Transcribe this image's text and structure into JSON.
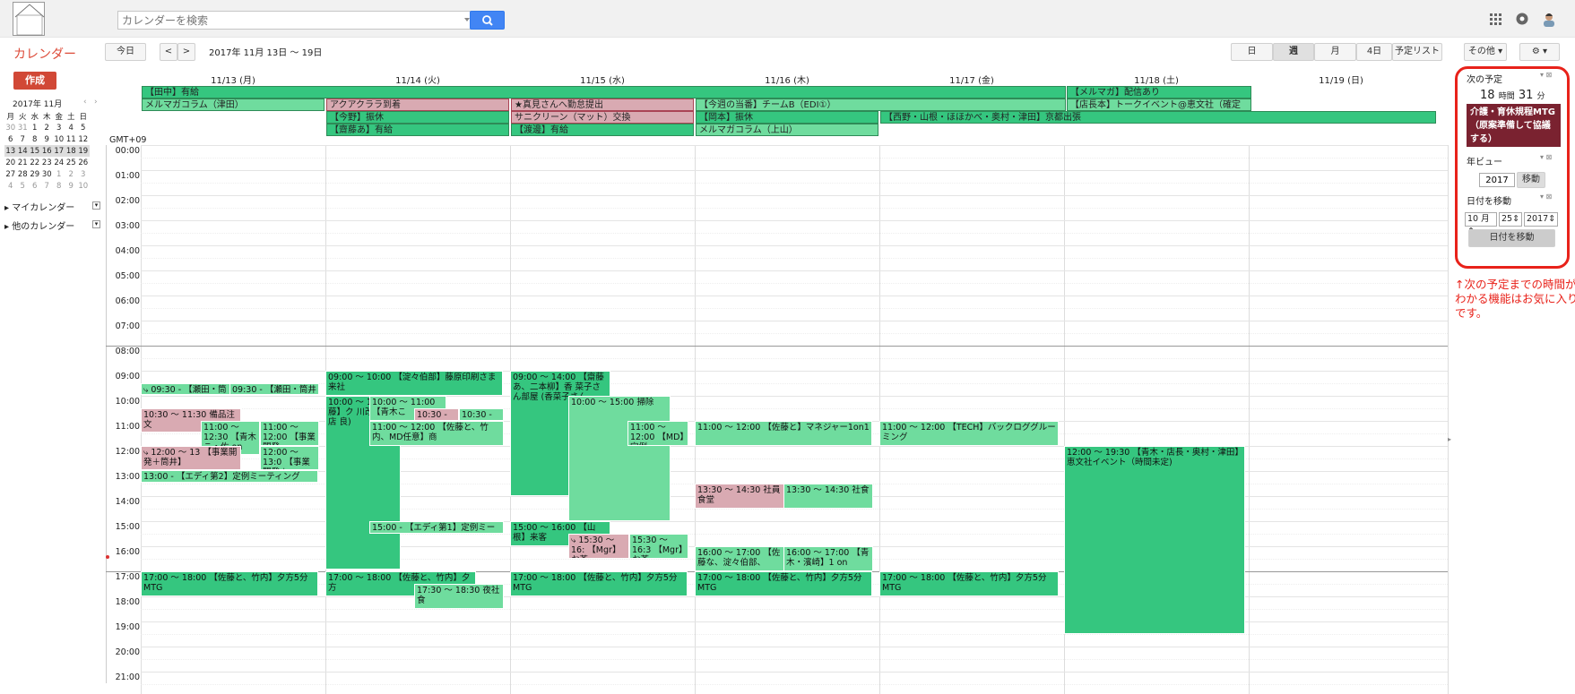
{
  "search": {
    "placeholder": "カレンダーを検索"
  },
  "app_title": "カレンダー",
  "toolbar": {
    "today": "今日",
    "prev": "<",
    "next": ">",
    "date_range": "2017年 11月 13日 〜 19日",
    "views": [
      "日",
      "週",
      "月",
      "4日",
      "予定リスト"
    ],
    "other": "その他",
    "settings": "⚙"
  },
  "create_label": "作成",
  "mini_cal": {
    "title": "2017年 11月",
    "weekdays": [
      "月",
      "火",
      "水",
      "木",
      "金",
      "土",
      "日"
    ],
    "weeks": [
      [
        "30",
        "31",
        "1",
        "2",
        "3",
        "4",
        "5"
      ],
      [
        "6",
        "7",
        "8",
        "9",
        "10",
        "11",
        "12"
      ],
      [
        "13",
        "14",
        "15",
        "16",
        "17",
        "18",
        "19"
      ],
      [
        "20",
        "21",
        "22",
        "23",
        "24",
        "25",
        "26"
      ],
      [
        "27",
        "28",
        "29",
        "30",
        "1",
        "2",
        "3"
      ],
      [
        "4",
        "5",
        "6",
        "7",
        "8",
        "9",
        "10"
      ]
    ]
  },
  "my_calendars": "マイカレンダー",
  "other_calendars": "他のカレンダー",
  "day_headers": [
    "11/13 (月)",
    "11/14 (火)",
    "11/15 (水)",
    "11/16 (木)",
    "11/17 (金)",
    "11/18 (土)",
    "11/19 (日)"
  ],
  "timezone": "GMT+09",
  "hours": [
    "00:00",
    "01:00",
    "02:00",
    "03:00",
    "04:00",
    "05:00",
    "06:00",
    "07:00",
    "08:00",
    "09:00",
    "10:00",
    "11:00",
    "12:00",
    "13:00",
    "14:00",
    "15:00",
    "16:00",
    "17:00",
    "18:00",
    "19:00",
    "20:00",
    "21:00"
  ],
  "allday": [
    "【田中】有給",
    "【メルマガ】配信あり",
    "メルマガコラム（津田）",
    "アクアクララ到着",
    "★真見さんへ勤怠提出",
    "【今週の当番】チームB（EDI①）",
    "【店長本】トークイベント@恵文社（確定",
    "【今野】振休",
    "サニクリーン（マット）交換",
    "【岡本】振休",
    "【西野・山根・ほほかべ・奥村・津田】京都出張",
    "【齋藤あ】有給",
    "【渡邊】有給",
    "メルマガコラム（上山）"
  ],
  "events": {
    "mon1": "⤷ 09:30 - 【瀬田・筒",
    "mon2": "09:30 - 【瀬田・筒井",
    "mon3": "10:30 〜 11:30 備品注文",
    "mon4": "11:00 〜 12:30 【青木こ・佐 on one",
    "mon5": "11:00 〜 12:00 【事業開発",
    "mon6": "⤷ 12:00 〜 13 【事業開発＋筒井】",
    "mon7": "12:00 〜 13:0 【事業開発＋",
    "mon8": "13:00 - 【エディ第2】定例ミーティング",
    "mon9": "17:00 〜 18:00 【佐藤と、竹内】夕方5分MTG",
    "tue1": "09:00 〜 10:00 【淀々伯部】藤原印刷さま来社",
    "tue2": "10:00 〜 1 【加藤】ク 川改七商店 良)",
    "tue3": "10:00 〜 11:00 【青木こ",
    "tue4": "10:30 - 【",
    "tue5": "10:30 - 【",
    "tue6": "11:00 〜 12:00 【佐藤と、竹内、MD任意】商",
    "tue7": "15:00 - 【エディ第1】定例ミー",
    "tue8": "17:00 〜 18:00 【佐藤と、竹内】夕方",
    "tue9": "17:30 〜 18:30 夜社食",
    "wed1": "09:00 〜 14:00 【齋藤あ、二本柳】香 菜子さん部屋 (香菜子さん",
    "wed2": "10:00 〜 15:00 掃除",
    "wed3": "11:00 〜 12:00 【MD】定例",
    "wed4": "15:00 〜 16:00 【山根】来客",
    "wed5": "⤷ 15:30 〜 16: 【Mgr】お茶",
    "wed6": "15:30 〜 16:3 【Mgr】お茶",
    "wed7": "17:00 〜 18:00 【佐藤と、竹内】夕方5分MTG",
    "thu1": "11:00 〜 12:00 【佐藤と】マネジャー1on1",
    "thu2": "13:30 〜 14:30 社員食堂",
    "thu3": "13:30 〜 14:30 社食",
    "thu4": "16:00 〜 17:00 【佐藤な、淀々伯部、",
    "thu5": "16:00 〜 17:00 【青木・濱崎】1 on",
    "thu6": "17:00 〜 18:00 【佐藤と、竹内】夕方5分MTG",
    "fri1": "11:00 〜 12:00 【TECH】バックロググルーミング",
    "fri2": "17:00 〜 18:00 【佐藤と、竹内】夕方5分MTG",
    "sat1": "12:00 〜 19:30 【青木・店長・奥村・津田】恵文社イベント（時間未定)"
  },
  "right_panel": {
    "next_title": "次の予定",
    "countdown_h": "18",
    "h_unit": "時間",
    "countdown_m": "31",
    "m_unit": "分",
    "next_event": "介護・育休規程MTG（原案準備して協議する）",
    "year_title": "年ビュー",
    "year_value": "2017",
    "year_btn": "移動",
    "goto_title": "日付を移動",
    "month_sel": "10 月",
    "day_sel": "25",
    "year_sel": "2017",
    "goto_btn": "日付を移動"
  },
  "annotation": "↑次の予定までの時間がわかる機能はお気に入りです。"
}
